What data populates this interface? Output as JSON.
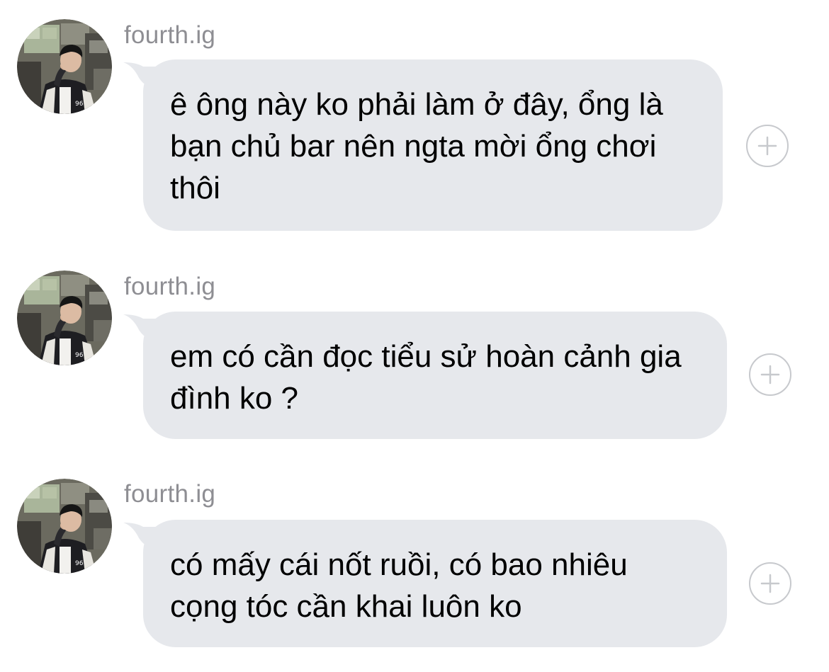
{
  "messages": [
    {
      "sender": "fourth.ig",
      "text": "ê ông này ko phải làm ở đây, ổng là bạn chủ bar nên ngta mời ổng chơi thôi",
      "avatar_icon": "profile-photo",
      "reaction_icon": "add-reaction-plus-icon"
    },
    {
      "sender": "fourth.ig",
      "text": "em có cần đọc tiểu sử hoàn cảnh gia đình ko ?",
      "avatar_icon": "profile-photo",
      "reaction_icon": "add-reaction-plus-icon"
    },
    {
      "sender": "fourth.ig",
      "text": "có mấy cái nốt ruồi, có bao nhiêu cọng tóc cần khai luôn ko",
      "avatar_icon": "profile-photo",
      "reaction_icon": "add-reaction-plus-icon"
    }
  ],
  "colors": {
    "bubble": "#e6e8ec",
    "sender": "#8e8e93",
    "message_text": "#000000",
    "reaction_outline": "#c7c9cd"
  }
}
